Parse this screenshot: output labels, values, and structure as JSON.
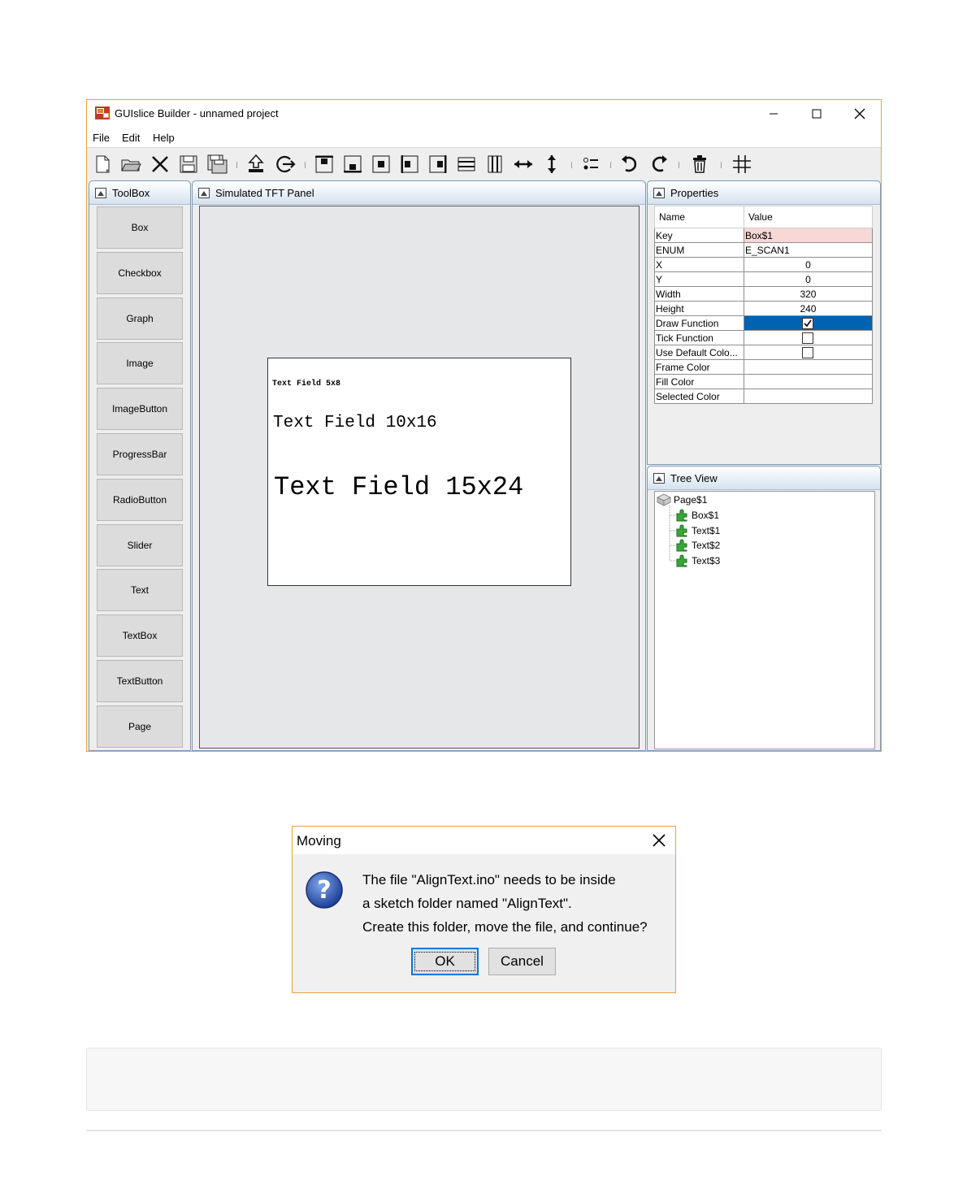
{
  "window": {
    "title": "GUIslice Builder - unnamed project",
    "menus": [
      "File",
      "Edit",
      "Help"
    ]
  },
  "toolbox": {
    "title": "ToolBox",
    "items": [
      "Box",
      "Checkbox",
      "Graph",
      "Image",
      "ImageButton",
      "ProgressBar",
      "RadioButton",
      "Slider",
      "Text",
      "TextBox",
      "TextButton",
      "Page"
    ]
  },
  "tft_panel": {
    "title": "Simulated TFT Panel",
    "texts": [
      "Text Field 5x8",
      "Text Field 10x16",
      "Text Field 15x24"
    ]
  },
  "properties": {
    "title": "Properties",
    "header": {
      "name": "Name",
      "value": "Value"
    },
    "rows": [
      {
        "name": "Key",
        "value": "Box$1"
      },
      {
        "name": "ENUM",
        "value": "E_SCAN1"
      },
      {
        "name": "X",
        "value": "0"
      },
      {
        "name": "Y",
        "value": "0"
      },
      {
        "name": "Width",
        "value": "320"
      },
      {
        "name": "Height",
        "value": "240"
      },
      {
        "name": "Draw Function",
        "value": "",
        "checkbox": true,
        "checked": true,
        "selected": true
      },
      {
        "name": "Tick Function",
        "value": "",
        "checkbox": true,
        "checked": false
      },
      {
        "name": "Use Default Colo...",
        "value": "",
        "checkbox": true,
        "checked": false
      },
      {
        "name": "Frame Color",
        "value": ""
      },
      {
        "name": "Fill Color",
        "value": ""
      },
      {
        "name": "Selected Color",
        "value": ""
      }
    ]
  },
  "tree_view": {
    "title": "Tree View",
    "root": "Page$1",
    "children": [
      "Box$1",
      "Text$1",
      "Text$2",
      "Text$3"
    ]
  },
  "dialog": {
    "title": "Moving",
    "lines": [
      "The file \"AlignText.ino\" needs to be inside",
      "a sketch folder named \"AlignText\".",
      "Create this folder, move the file, and continue?"
    ],
    "ok_label": "OK",
    "cancel_label": "Cancel"
  },
  "colors": {
    "window_border": "#e8a33d",
    "selected_row": "#0063b1",
    "key_highlight": "#f8d7d7",
    "panel_border": "#7d9ab5"
  }
}
